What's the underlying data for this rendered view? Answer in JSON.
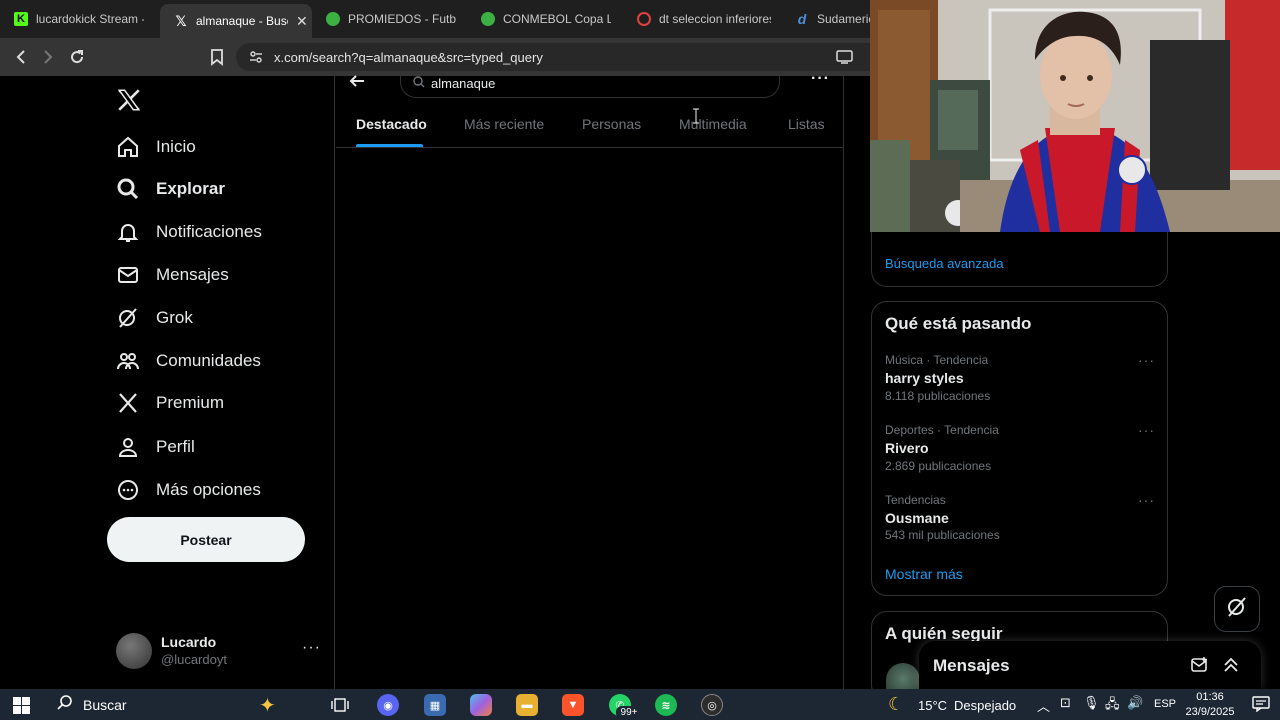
{
  "browser": {
    "tabs": [
      {
        "title": "lucardokick Stream - V",
        "favicon": "kick-icon",
        "color": "#53fc18"
      },
      {
        "title": "almanaque - Busca",
        "favicon": "x-logo-icon",
        "color": "#ffffff"
      },
      {
        "title": "PROMIEDOS - Futbol",
        "favicon": "soccer-ball-icon",
        "color": "#3cb043"
      },
      {
        "title": "CONMEBOL Copa Liber",
        "favicon": "soccer-ball-icon",
        "color": "#3cb043"
      },
      {
        "title": "dt seleccion inferiores",
        "favicon": "record-icon",
        "color": "#e04040"
      },
      {
        "title": "Sudameric",
        "favicon": "d-icon",
        "color": "#4a90d9"
      }
    ],
    "url": "x.com/search?q=almanaque&src=typed_query"
  },
  "nav": {
    "items": [
      {
        "label": "Inicio",
        "icon": "home-icon"
      },
      {
        "label": "Explorar",
        "icon": "search-icon"
      },
      {
        "label": "Notificaciones",
        "icon": "bell-icon"
      },
      {
        "label": "Mensajes",
        "icon": "mail-icon"
      },
      {
        "label": "Grok",
        "icon": "grok-icon"
      },
      {
        "label": "Comunidades",
        "icon": "people-icon"
      },
      {
        "label": "Premium",
        "icon": "x-logo-icon"
      },
      {
        "label": "Perfil",
        "icon": "person-icon"
      },
      {
        "label": "Más opciones",
        "icon": "more-circle-icon"
      }
    ],
    "post_label": "Postear",
    "profile": {
      "name": "Lucardo",
      "handle": "@lucardoyt"
    }
  },
  "search": {
    "query": "almanaque",
    "tabs": [
      "Destacado",
      "Más reciente",
      "Personas",
      "Multimedia",
      "Listas"
    ],
    "active_tab": "Destacado"
  },
  "sidebar": {
    "advanced_search": "Búsqueda avanzada",
    "trending_title": "Qué está pasando",
    "trends": [
      {
        "category": "Música · Tendencia",
        "name": "harry styles",
        "count": "8.118 publicaciones"
      },
      {
        "category": "Deportes · Tendencia",
        "name": "Rivero",
        "count": "2.869 publicaciones"
      },
      {
        "category": "Tendencias",
        "name": "Ousmane",
        "count": "543 mil publicaciones"
      }
    ],
    "show_more": "Mostrar más",
    "who_to_follow": "A quién seguir",
    "messages_title": "Mensajes"
  },
  "taskbar": {
    "search_label": "Buscar",
    "weather_temp": "15°C",
    "weather_desc": "Despejado",
    "language": "ESP",
    "time": "01:36",
    "date": "23/9/2025",
    "whatsapp_badge": "99+"
  },
  "colors": {
    "accent": "#1d9bf0",
    "background": "#000000",
    "border": "#2f3336"
  }
}
